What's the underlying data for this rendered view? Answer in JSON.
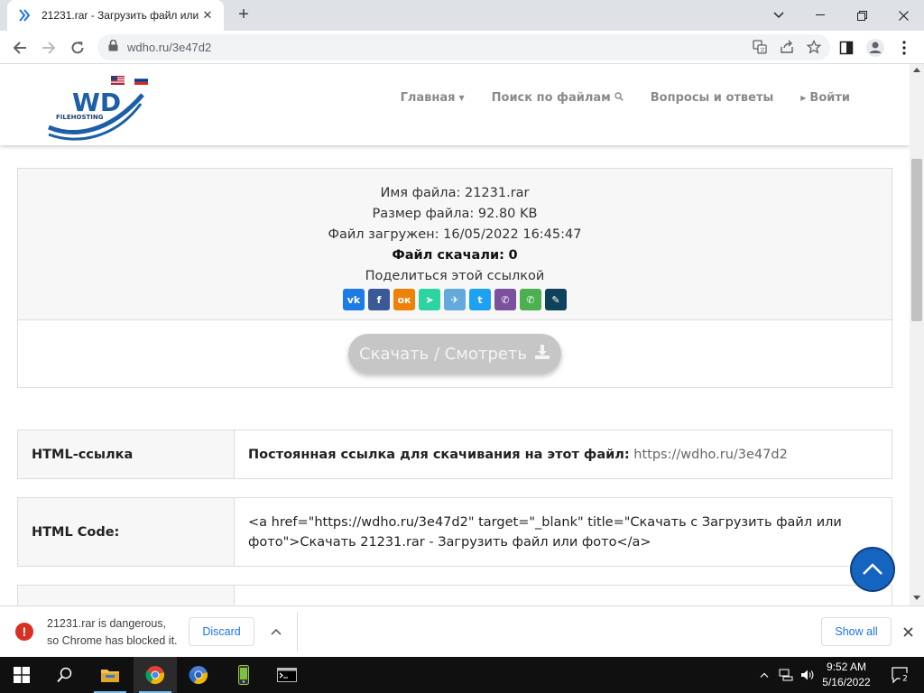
{
  "browser": {
    "tab_title": "21231.rar - Загрузить файл или фото",
    "url": "wdho.ru/3e47d2"
  },
  "site": {
    "logo_text": "WD",
    "logo_sub": "FILEHOSTING",
    "nav": [
      {
        "label": "Главная"
      },
      {
        "label": "Поиск по файлам"
      },
      {
        "label": "Вопросы и ответы"
      },
      {
        "label": "Войти"
      }
    ]
  },
  "file": {
    "name_label": "Имя файла:",
    "name_value": "21231.rar",
    "size_label": "Размер файла:",
    "size_value": "92.80 KB",
    "uploaded_label": "Файл загружен:",
    "uploaded_value": "16/05/2022 16:45:47",
    "downloads_label": "Файл скачали:",
    "downloads_value": "0",
    "share_label": "Поделиться этой ссылкой",
    "share_buttons": [
      {
        "name": "vk-icon",
        "glyph": "vk",
        "color": "#1e7be6"
      },
      {
        "name": "facebook-icon",
        "glyph": "f",
        "color": "#3b5998"
      },
      {
        "name": "odnoklassniki-icon",
        "glyph": "ок",
        "color": "#ee8208"
      },
      {
        "name": "moimir-icon",
        "glyph": "➤",
        "color": "#2bd4a0"
      },
      {
        "name": "telegram-icon",
        "glyph": "✈",
        "color": "#64a9dc"
      },
      {
        "name": "twitter-icon",
        "glyph": "t",
        "color": "#1da1f2"
      },
      {
        "name": "viber-icon",
        "glyph": "✆",
        "color": "#7b519d"
      },
      {
        "name": "whatsapp-icon",
        "glyph": "✆",
        "color": "#4caf50"
      },
      {
        "name": "livejournal-icon",
        "glyph": "✎",
        "color": "#0d425a"
      }
    ],
    "download_button": "Скачать / Смотреть"
  },
  "rows": [
    {
      "key": "HTML-ссылка",
      "value_bold": "Постоянная ссылка для скачивания на этот файл:",
      "value_link": "https://wdho.ru/3e47d2"
    },
    {
      "key": "HTML Code:",
      "value": "<a href=\"https://wdho.ru/3e47d2\" target=\"_blank\" title=\"Скачать с Загрузить файл или фото\">Скачать 21231.rar - Загрузить файл или фото</a>"
    }
  ],
  "download_shelf": {
    "message_line1": "21231.rar is dangerous,",
    "message_line2": "so Chrome has blocked it.",
    "discard": "Discard",
    "show_all": "Show all"
  },
  "taskbar": {
    "time": "9:52 AM",
    "date": "5/16/2022",
    "notifications": "2"
  },
  "colors": {
    "accent": "#1565c0",
    "logo_blue": "#1d5ea8",
    "download_btn": "#c6c6c6",
    "danger": "#d93025"
  }
}
